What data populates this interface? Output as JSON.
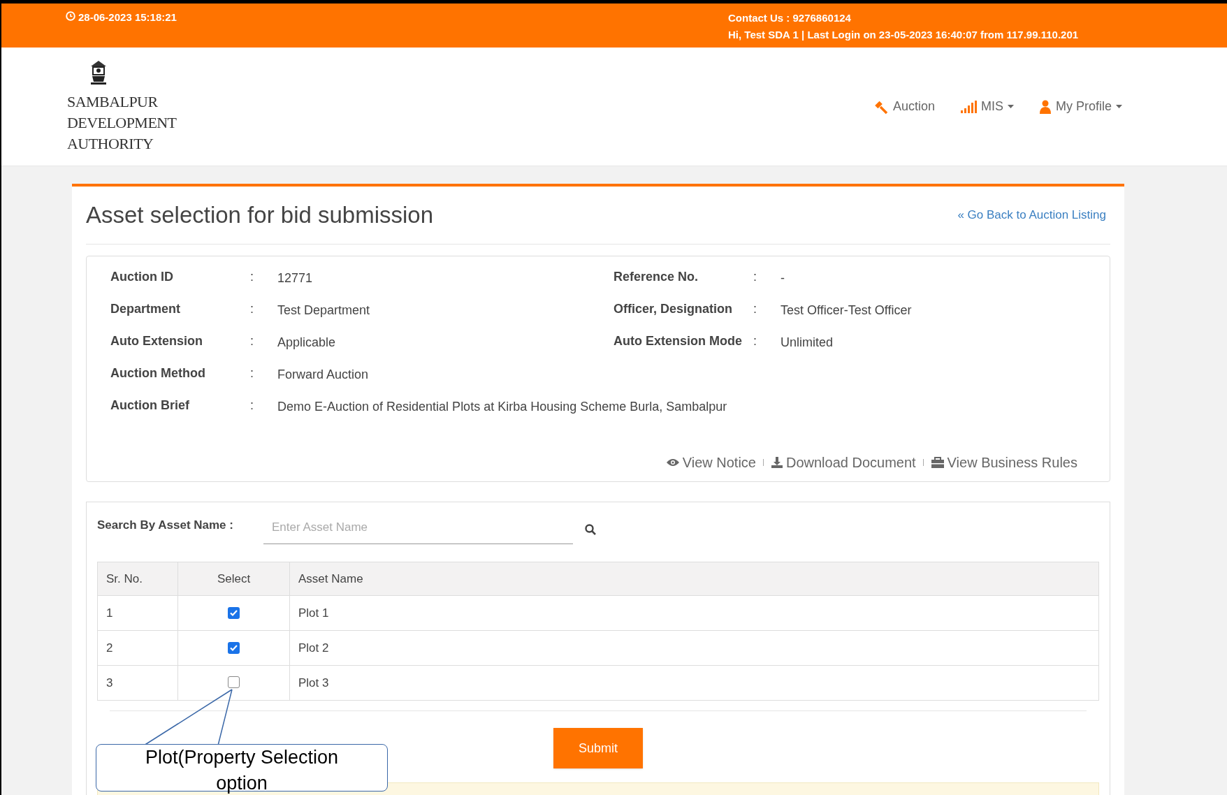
{
  "top_bar": {
    "datetime": "28-06-2023 15:18:21",
    "contact": "Contact Us : 9276860124",
    "login_info": "Hi, Test SDA 1 | Last Login on 23-05-2023 16:40:07 from 117.99.110.201"
  },
  "logo": {
    "lines": [
      "SAMBALPUR",
      "DEVELOPMENT",
      "AUTHORITY"
    ]
  },
  "nav": [
    {
      "label": "Auction",
      "kind": "gavel",
      "dropdown": false
    },
    {
      "label": "MIS",
      "kind": "signal",
      "dropdown": true
    },
    {
      "label": "My Profile",
      "kind": "user",
      "dropdown": true
    }
  ],
  "page_title": "Asset selection for bid submission",
  "back_link": "« Go Back to Auction Listing",
  "details": [
    {
      "label": "Auction ID",
      "value": "12771"
    },
    {
      "label": "Reference No.",
      "value": "-"
    },
    {
      "label": "Department",
      "value": "Test Department"
    },
    {
      "label": "Officer, Designation",
      "value": "Test Officer-Test Officer"
    },
    {
      "label": "Auto Extension",
      "value": "Applicable"
    },
    {
      "label": "Auto Extension Mode",
      "value": "Unlimited"
    },
    {
      "label": "Auction Method",
      "value": "Forward Auction"
    },
    {
      "label": "Auction Brief",
      "value": "Demo E-Auction of Residential Plots at Kirba Housing Scheme Burla, Sambalpur",
      "wide": true
    }
  ],
  "separator": ":",
  "doc_links": [
    {
      "label": "View Notice",
      "kind": "eye"
    },
    {
      "label": "Download Document",
      "kind": "download"
    },
    {
      "label": "View Business Rules",
      "kind": "briefcase"
    }
  ],
  "search": {
    "label": "Search By Asset Name :",
    "placeholder": "Enter Asset Name"
  },
  "table": {
    "columns": [
      "Sr. No.",
      "Select",
      "Asset Name"
    ],
    "rows": [
      {
        "sr": "1",
        "checked": true,
        "asset": "Plot 1"
      },
      {
        "sr": "2",
        "checked": true,
        "asset": "Plot 2"
      },
      {
        "sr": "3",
        "checked": false,
        "asset": "Plot 3"
      }
    ]
  },
  "submit": "Submit",
  "callout": "Plot(Property Selection option"
}
